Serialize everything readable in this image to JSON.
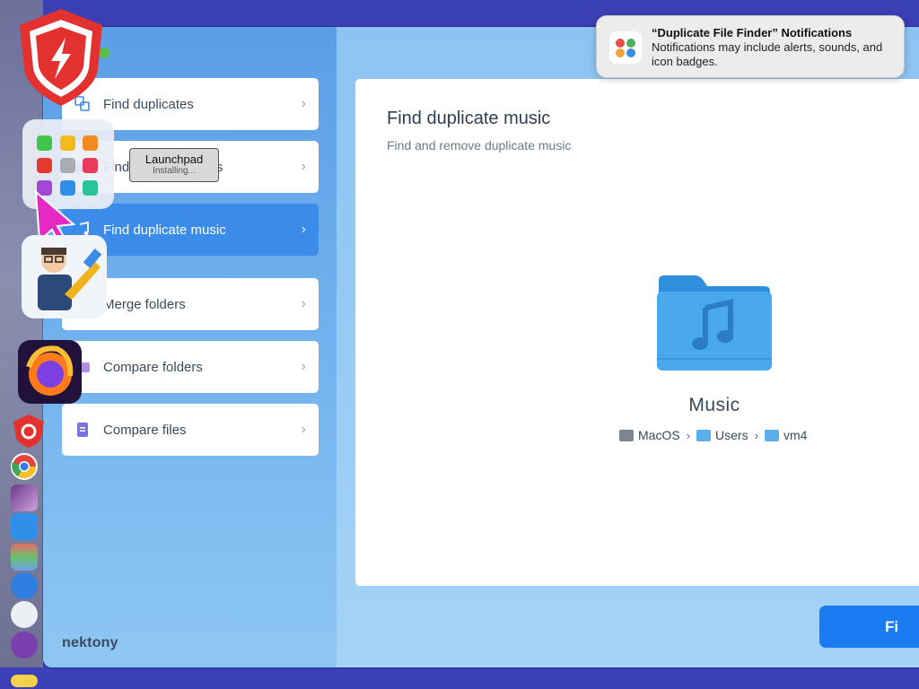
{
  "notification": {
    "title": "“Duplicate File Finder” Notifications",
    "body": "Notifications may include alerts, sounds, and icon badges."
  },
  "sidebar": {
    "items": [
      {
        "label": "Find duplicates",
        "icon": "duplicates-icon",
        "active": false
      },
      {
        "label": "Find similar pictures",
        "icon": "pictures-icon",
        "active": false
      },
      {
        "label": "Find duplicate music",
        "icon": "music-icon",
        "active": true
      },
      {
        "label": "Merge folders",
        "icon": "merge-icon",
        "active": false
      },
      {
        "label": "Compare folders",
        "icon": "folder-compare-icon",
        "active": false
      },
      {
        "label": "Compare files",
        "icon": "file-compare-icon",
        "active": false
      }
    ],
    "brand": "nektony"
  },
  "main": {
    "title": "Find duplicate music",
    "subtitle": "Find and remove duplicate music",
    "folder_name": "Music",
    "path": [
      "MacOS",
      "Users",
      "vm4"
    ],
    "button_label": "Fi"
  },
  "dock": {
    "tooltip_title": "Launchpad",
    "tooltip_status": "Installing..."
  },
  "colors": {
    "accent": "#3b8ce8",
    "button": "#1a7cf0"
  }
}
